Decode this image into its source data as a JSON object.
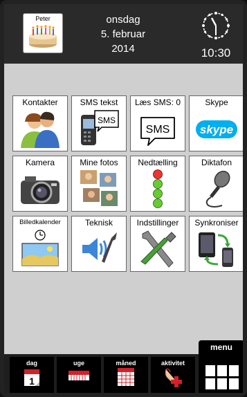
{
  "header": {
    "birthday_name": "Peter",
    "weekday": "onsdag",
    "date": "5. februar",
    "year": "2014",
    "time": "10:30"
  },
  "tiles": [
    {
      "label": "Kontakter",
      "icon": "contacts-icon"
    },
    {
      "label": "SMS tekst",
      "icon": "sms-write-icon",
      "badge": "SMS"
    },
    {
      "label": "Læs SMS: 0",
      "icon": "sms-read-icon",
      "badge": "SMS"
    },
    {
      "label": "Skype",
      "icon": "skype-icon",
      "badge": "skype"
    },
    {
      "label": "Kamera",
      "icon": "camera-icon"
    },
    {
      "label": "Mine fotos",
      "icon": "photos-icon"
    },
    {
      "label": "Nedtælling",
      "icon": "countdown-icon"
    },
    {
      "label": "Diktafon",
      "icon": "microphone-icon"
    },
    {
      "label": "Billedkalender",
      "icon": "picture-calendar-icon"
    },
    {
      "label": "Teknisk",
      "icon": "speaker-wrench-icon"
    },
    {
      "label": "Indstillinger",
      "icon": "tools-icon"
    },
    {
      "label": "Synkroniser",
      "icon": "sync-icon"
    }
  ],
  "nav": {
    "day": "dag",
    "week": "uge",
    "month": "måned",
    "activity": "aktivitet",
    "menu": "menu"
  },
  "colors": {
    "header_bg": "#2a2a2a",
    "screen_bg": "#cfcfcf",
    "accent_red": "#d4202a",
    "skype_blue": "#00aff0"
  }
}
